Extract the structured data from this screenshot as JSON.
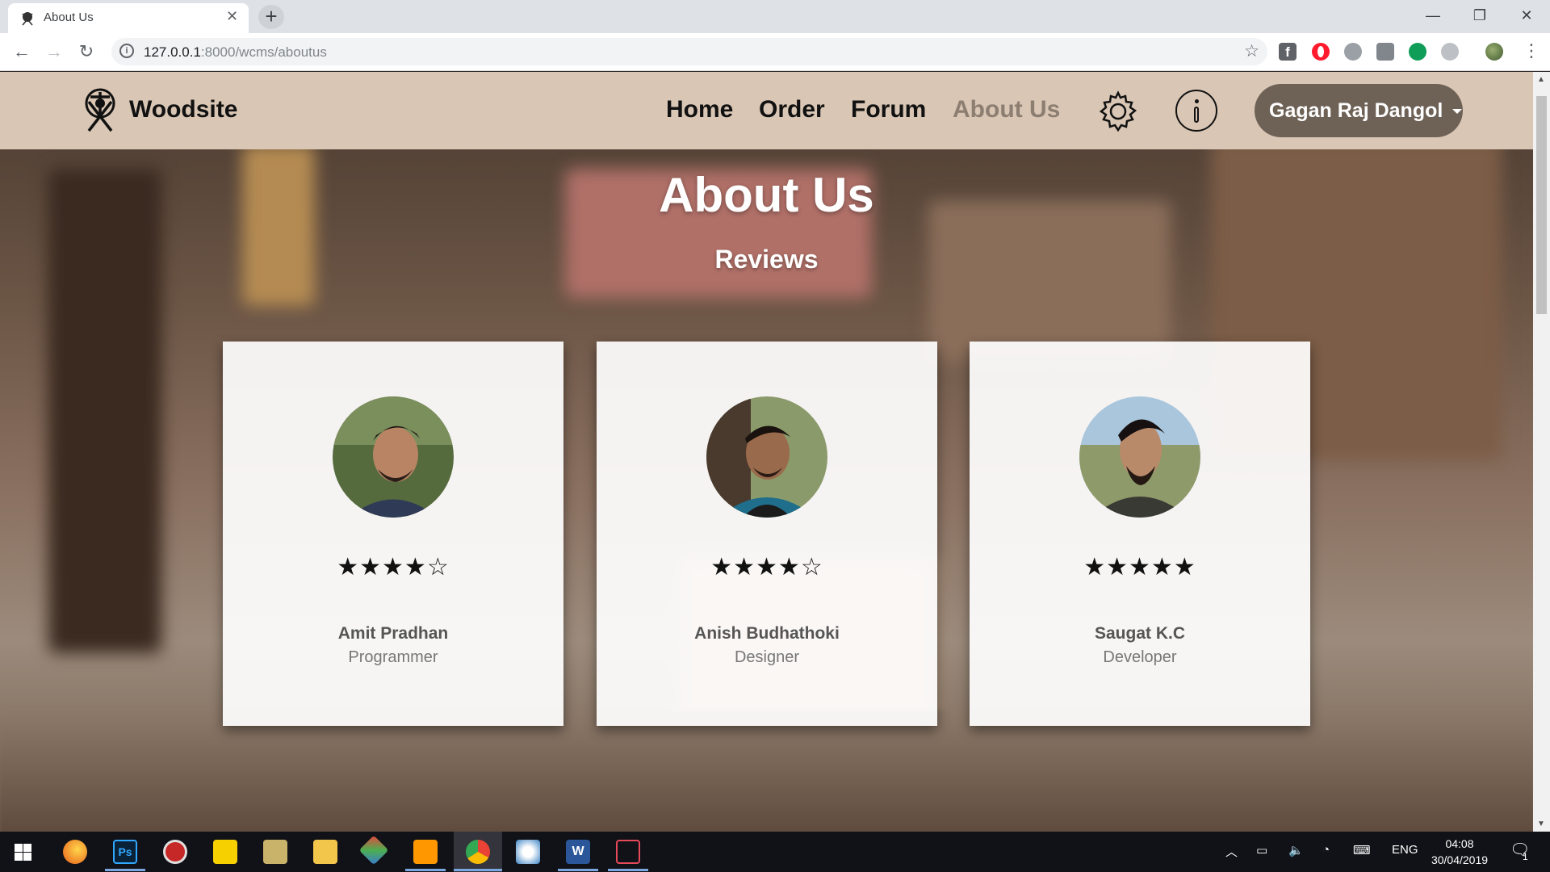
{
  "browser": {
    "tab_title": "About Us",
    "url_host": "127.0.0.1",
    "url_rest": ":8000/wcms/aboutus"
  },
  "navbar": {
    "brand": "Woodsite",
    "links": [
      "Home",
      "Order",
      "Forum",
      "About Us"
    ],
    "active_link": "About Us",
    "user_name": "Gagan Raj Dangol"
  },
  "main": {
    "title": "About Us",
    "subtitle": "Reviews",
    "reviews": [
      {
        "name": "Amit Pradhan",
        "role": "Programmer",
        "stars": "★★★★☆",
        "rating": 4
      },
      {
        "name": "Anish Budhathoki",
        "role": "Designer",
        "stars": "★★★★☆",
        "rating": 4
      },
      {
        "name": "Saugat K.C",
        "role": "Developer",
        "stars": "★★★★★",
        "rating": 5
      }
    ]
  },
  "taskbar": {
    "language": "ENG",
    "time": "04:08",
    "date": "30/04/2019",
    "notification_count": "1",
    "icons": [
      "windows-start-icon",
      "edge-icon",
      "photoshop-icon",
      "dial-icon",
      "sticky-notes-icon",
      "notepad-icon",
      "file-explorer-icon",
      "git-icon",
      "sublime-icon",
      "chrome-icon",
      "paint-icon",
      "word-icon",
      "snipping-icon"
    ]
  },
  "colors": {
    "navbar_bg": "#d9c6b4",
    "active_link": "#8d7e72",
    "user_button_bg": "#6e6156",
    "card_bg": "#ffffff"
  }
}
